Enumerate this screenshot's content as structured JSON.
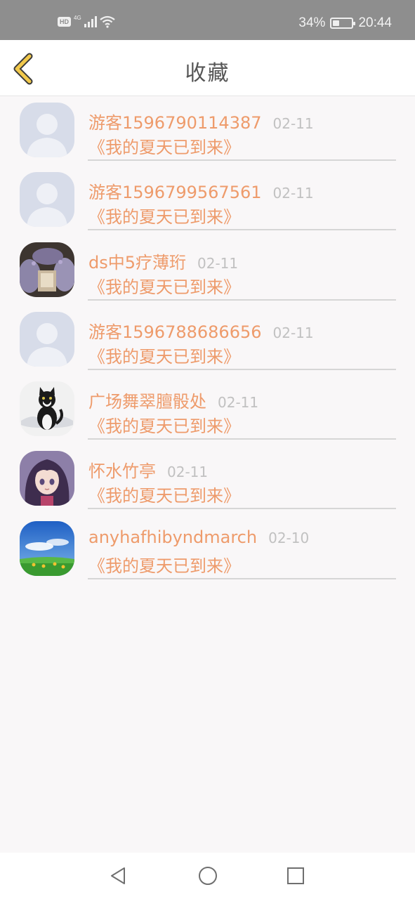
{
  "status_bar": {
    "hd": "HD",
    "network": "4G",
    "battery": "34%",
    "battery_level": 0.34,
    "time": "20:44"
  },
  "header": {
    "title": "收藏"
  },
  "items": [
    {
      "name": "游客1596790114387",
      "date": "02-11",
      "subtitle": "《我的夏天已到来》",
      "avatar": "default-avatar"
    },
    {
      "name": "游客1596799567561",
      "date": "02-11",
      "subtitle": "《我的夏天已到来》",
      "avatar": "default-avatar"
    },
    {
      "name": "ds中5疗薄珩",
      "date": "02-11",
      "subtitle": "《我的夏天已到来》",
      "avatar": "lavender-photo"
    },
    {
      "name": "游客1596788686656",
      "date": "02-11",
      "subtitle": "《我的夏天已到来》",
      "avatar": "default-avatar"
    },
    {
      "name": "广场舞翠膻骰处",
      "date": "02-11",
      "subtitle": "《我的夏天已到来》",
      "avatar": "cat-photo"
    },
    {
      "name": "怀水竹亭",
      "date": "02-11",
      "subtitle": "《我的夏天已到来》",
      "avatar": "anime-girl-photo"
    },
    {
      "name": "anyhafhibyndmarch",
      "date": "02-10",
      "subtitle": "《我的夏天已到来》",
      "avatar": "sky-field-photo"
    }
  ],
  "colors": {
    "accent": "#ee9b6b",
    "back_arrow": "#f2c94c",
    "date": "#c1c1c1"
  }
}
